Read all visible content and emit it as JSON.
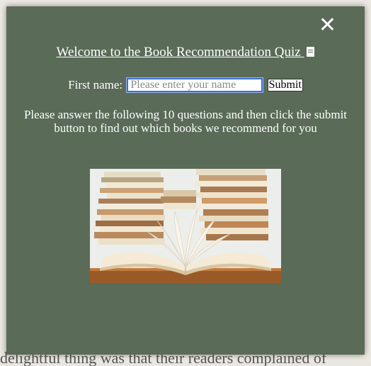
{
  "background_page": {
    "partial_text": "delightful thing was that their readers complained of"
  },
  "modal": {
    "close_glyph": "✕",
    "title": "Welcome to the Book Recommendation Quiz",
    "title_icon": "book-icon",
    "form": {
      "label": "First name:",
      "placeholder": "Please enter your name",
      "value": "",
      "submit_label": "Submit"
    },
    "instructions": "Please answer the following 10 questions and then click the submit button to find out which books we recommend for you",
    "image": {
      "subject": "open book in front of stacked books",
      "icon": "books-photo"
    }
  },
  "colors": {
    "modal_bg": "#5a6b58",
    "text": "#ffffff",
    "input_border": "#3b6fd1"
  }
}
